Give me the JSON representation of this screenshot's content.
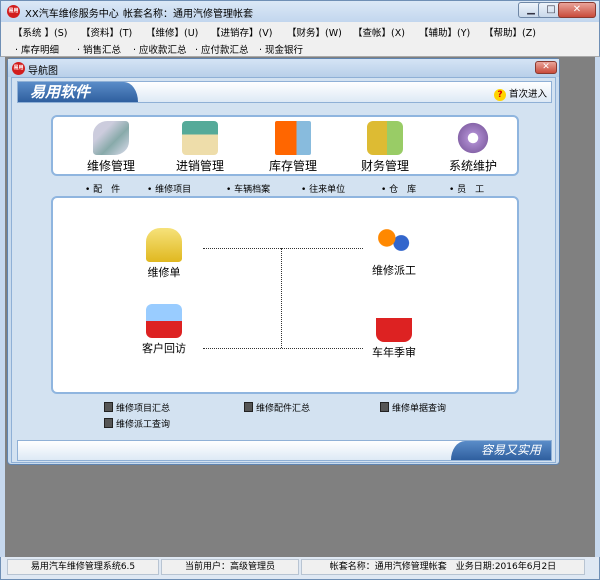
{
  "window": {
    "title": "XX汽车维修服务中心",
    "account_title": "帐套名称：通用汽修管理帐套",
    "logo_text": "易用",
    "minimize": "▁",
    "maximize": "□",
    "close": "✕"
  },
  "menu": [
    "【系统 】(S)",
    "【资料】(T)",
    "【维修】(U)",
    "【进销存】(V)",
    "【财务】(W)",
    "【查帐】(X)",
    "【辅助】(Y)",
    "【帮助】(Z)"
  ],
  "toolbar": [
    "· 库存明细",
    "· 销售汇总",
    "· 应收款汇总",
    "· 应付款汇总",
    "· 现金银行"
  ],
  "child": {
    "title": "导航图",
    "close": "✕",
    "banner_brand": "易用软件",
    "first_entry": "首次进入",
    "help_icon": "?",
    "footer_slogan": "容易又实用"
  },
  "modules": [
    {
      "label": "维修管理",
      "icon": "repair-icon"
    },
    {
      "label": "进销管理",
      "icon": "purchase-sale-icon"
    },
    {
      "label": "库存管理",
      "icon": "inventory-icon"
    },
    {
      "label": "财务管理",
      "icon": "finance-icon"
    },
    {
      "label": "系统维护",
      "icon": "gear-icon"
    }
  ],
  "sub_links": [
    "• 配　件",
    "• 维修项目",
    "• 车辆档案",
    "• 往来单位",
    "• 仓　库",
    "• 员　工"
  ],
  "flow": {
    "repair_order": "维修单",
    "dispatch": "维修派工",
    "customer_visit": "客户回访",
    "annual_review": "车年季审"
  },
  "reports": [
    "维修项目汇总",
    "维修配件汇总",
    "维修单据查询",
    "维修派工查询"
  ],
  "status": {
    "system": "易用汽车维修管理系统6.5",
    "user": "当前用户：高级管理员",
    "account": "帐套名称：通用汽修管理帐套　业务日期:2016年6月2日"
  },
  "colors": {
    "accent": "#2f5f9f",
    "panel_border": "#8fb5df",
    "workspace": "#808080"
  }
}
